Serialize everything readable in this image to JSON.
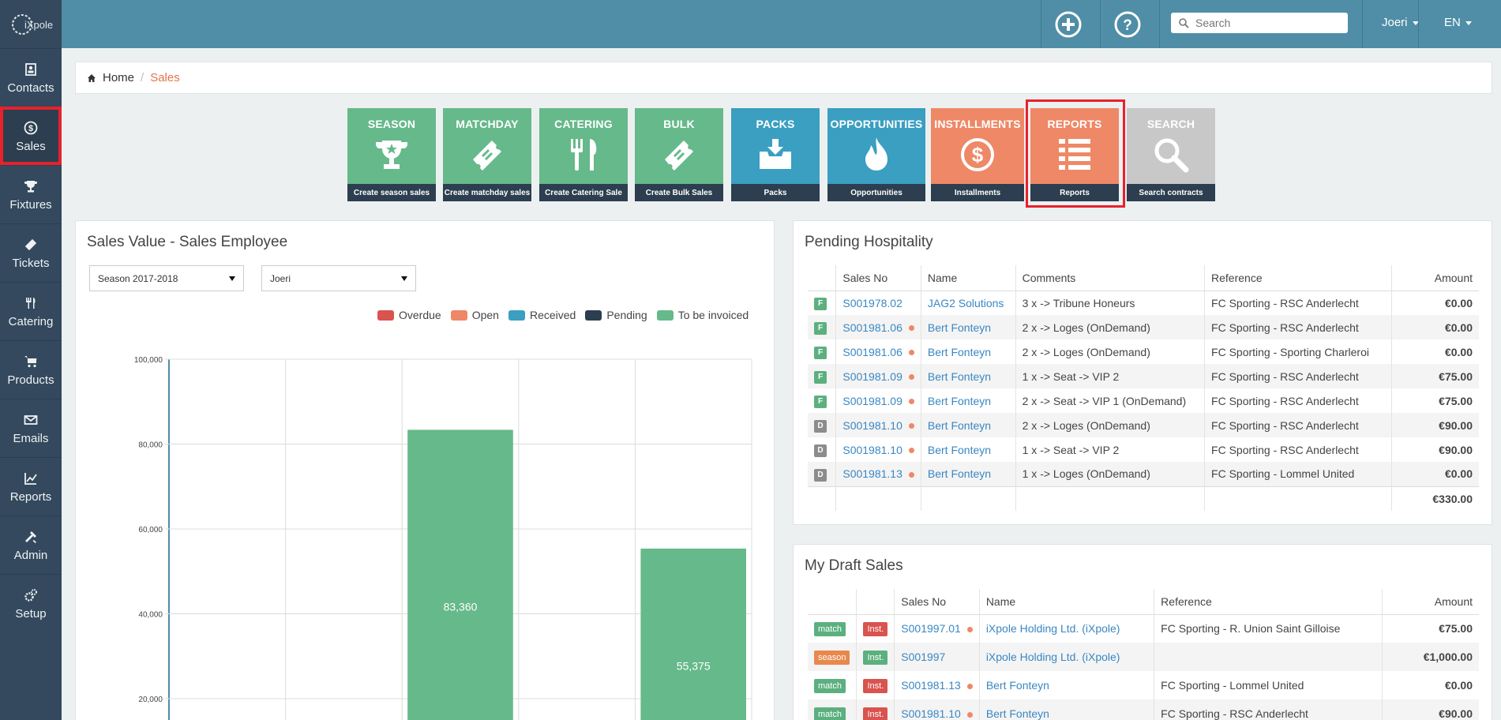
{
  "app": {
    "logo_text": "iXpole",
    "colors": {
      "topbar": "#4f8ea6",
      "sidebar": "#34495e",
      "accent": "#e8734d",
      "green": "#66b98a",
      "blue": "#3a9fc1",
      "highlight": "#e8212b"
    }
  },
  "sidebar": {
    "items": [
      {
        "label": "Contacts",
        "icon": "contacts-icon"
      },
      {
        "label": "Sales",
        "icon": "dollar-icon",
        "active": true
      },
      {
        "label": "Fixtures",
        "icon": "trophy-icon"
      },
      {
        "label": "Tickets",
        "icon": "ticket-icon"
      },
      {
        "label": "Catering",
        "icon": "cutlery-icon"
      },
      {
        "label": "Products",
        "icon": "cart-icon"
      },
      {
        "label": "Emails",
        "icon": "envelope-icon"
      },
      {
        "label": "Reports",
        "icon": "chart-icon"
      },
      {
        "label": "Admin",
        "icon": "tools-icon"
      },
      {
        "label": "Setup",
        "icon": "gears-icon"
      }
    ]
  },
  "topbar": {
    "search_placeholder": "Search",
    "user": "Joeri",
    "language": "EN"
  },
  "breadcrumb": {
    "home": "Home",
    "current": "Sales"
  },
  "tiles": [
    {
      "title": "SEASON",
      "footer": "Create season sales",
      "icon": "trophy-icon"
    },
    {
      "title": "MATCHDAY",
      "footer": "Create matchday sales",
      "icon": "ticket-icon"
    },
    {
      "title": "CATERING",
      "footer": "Create Catering Sale",
      "icon": "cutlery-icon"
    },
    {
      "title": "BULK",
      "footer": "Create Bulk Sales",
      "icon": "ticket-icon"
    },
    {
      "title": "PACKS",
      "footer": "Packs",
      "icon": "inbox-download-icon"
    },
    {
      "title": "OPPORTUNITIES",
      "footer": "Opportunities",
      "icon": "flame-icon"
    },
    {
      "title": "INSTALLMENTS",
      "footer": "Installments",
      "icon": "dollar-circle-icon"
    },
    {
      "title": "REPORTS",
      "footer": "Reports",
      "icon": "list-icon"
    },
    {
      "title": "SEARCH",
      "footer": "Search contracts",
      "icon": "magnifier-icon"
    }
  ],
  "sales_chart": {
    "panel_title": "Sales Value - Sales Employee",
    "season_select": "Season 2017-2018",
    "employee_select": "Joeri",
    "legend": [
      {
        "label": "Overdue",
        "color": "#d9534f"
      },
      {
        "label": "Open",
        "color": "#ee8866"
      },
      {
        "label": "Received",
        "color": "#3a9fc1"
      },
      {
        "label": "Pending",
        "color": "#2c3e50"
      },
      {
        "label": "To be invoiced",
        "color": "#66b98a"
      }
    ]
  },
  "chart_data": {
    "type": "bar",
    "title": "Sales Value - Sales Employee",
    "ylim": [
      0,
      100000
    ],
    "y_ticks": [
      "20,000",
      "40,000",
      "60,000",
      "80,000",
      "100,000"
    ],
    "y_tick_values": [
      20000,
      40000,
      60000,
      80000,
      100000
    ],
    "series": [
      {
        "name": "To be invoiced",
        "values": [
          null,
          null,
          83360,
          null,
          55375
        ],
        "labels": [
          "",
          "",
          "83,360",
          "",
          "55,375"
        ]
      }
    ],
    "categories": [
      "",
      "",
      "",
      "",
      ""
    ],
    "grid": true
  },
  "pending_hospitality": {
    "panel_title": "Pending Hospitality",
    "columns": [
      "",
      "Sales No",
      "Name",
      "Comments",
      "Reference",
      "Amount"
    ],
    "rows": [
      {
        "type": "F",
        "sales_no": "S001978.02",
        "dot": false,
        "name": "JAG2 Solutions",
        "comments": "3 x -> Tribune Honeurs",
        "reference": "FC Sporting - RSC Anderlecht",
        "amount": "€0.00"
      },
      {
        "type": "F",
        "sales_no": "S001981.06",
        "dot": true,
        "name": "Bert Fonteyn",
        "comments": "2 x -> Loges (OnDemand)",
        "reference": "FC Sporting - RSC Anderlecht",
        "amount": "€0.00"
      },
      {
        "type": "F",
        "sales_no": "S001981.06",
        "dot": true,
        "name": "Bert Fonteyn",
        "comments": "2 x -> Loges (OnDemand)",
        "reference": "FC Sporting - Sporting Charleroi",
        "amount": "€0.00"
      },
      {
        "type": "F",
        "sales_no": "S001981.09",
        "dot": true,
        "name": "Bert Fonteyn",
        "comments": "1 x -> Seat -> VIP 2",
        "reference": "FC Sporting - RSC Anderlecht",
        "amount": "€75.00"
      },
      {
        "type": "F",
        "sales_no": "S001981.09",
        "dot": true,
        "name": "Bert Fonteyn",
        "comments": "2 x -> Seat -> VIP 1 (OnDemand)",
        "reference": "FC Sporting - RSC Anderlecht",
        "amount": "€75.00"
      },
      {
        "type": "D",
        "sales_no": "S001981.10",
        "dot": true,
        "name": "Bert Fonteyn",
        "comments": "2 x -> Loges (OnDemand)",
        "reference": "FC Sporting - RSC Anderlecht",
        "amount": "€90.00"
      },
      {
        "type": "D",
        "sales_no": "S001981.10",
        "dot": true,
        "name": "Bert Fonteyn",
        "comments": "1 x -> Seat -> VIP 2",
        "reference": "FC Sporting - RSC Anderlecht",
        "amount": "€90.00"
      },
      {
        "type": "D",
        "sales_no": "S001981.13",
        "dot": true,
        "name": "Bert Fonteyn",
        "comments": "1 x -> Loges (OnDemand)",
        "reference": "FC Sporting - Lommel United",
        "amount": "€0.00"
      }
    ],
    "total": "€330.00"
  },
  "draft_sales": {
    "panel_title": "My Draft Sales",
    "columns": [
      "",
      "",
      "Sales No",
      "Name",
      "Reference",
      "Amount"
    ],
    "rows": [
      {
        "kind": "match",
        "inst": "Inst.",
        "inst_color": "red",
        "sales_no": "S001997.01",
        "dot": true,
        "name": "iXpole Holding Ltd. (iXpole)",
        "reference": "FC Sporting - R. Union Saint Gilloise",
        "amount": "€75.00"
      },
      {
        "kind": "season",
        "inst": "Inst.",
        "inst_color": "green",
        "sales_no": "S001997",
        "dot": false,
        "name": "iXpole Holding Ltd. (iXpole)",
        "reference": "",
        "amount": "€1,000.00"
      },
      {
        "kind": "match",
        "inst": "Inst.",
        "inst_color": "red",
        "sales_no": "S001981.13",
        "dot": true,
        "name": "Bert Fonteyn",
        "reference": "FC Sporting - Lommel United",
        "amount": "€0.00"
      },
      {
        "kind": "match",
        "inst": "Inst.",
        "inst_color": "red",
        "sales_no": "S001981.10",
        "dot": true,
        "name": "Bert Fonteyn",
        "reference": "FC Sporting - RSC Anderlecht",
        "amount": "€90.00"
      }
    ]
  }
}
